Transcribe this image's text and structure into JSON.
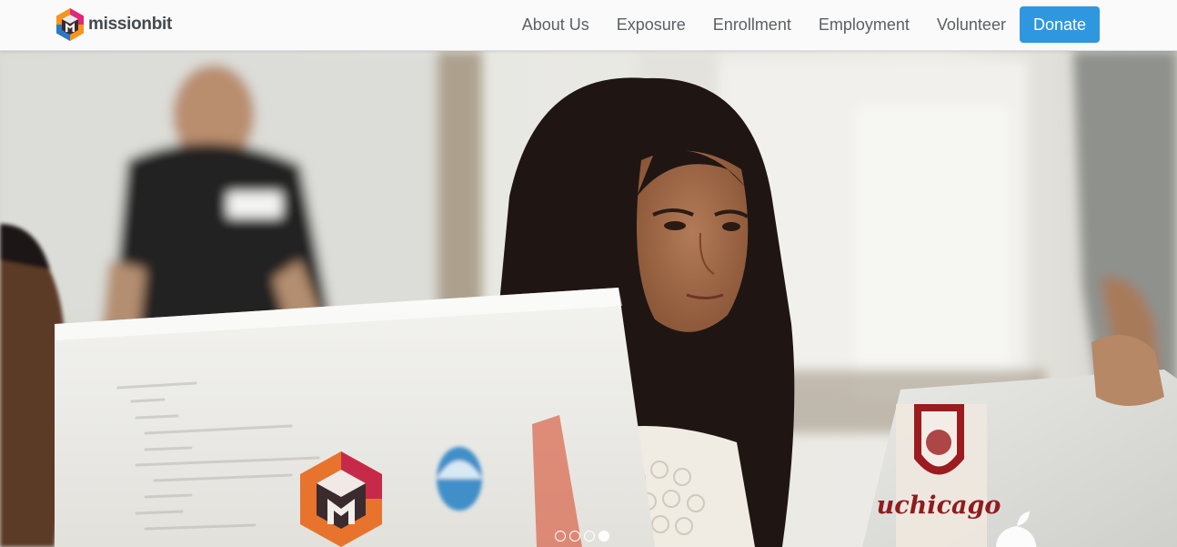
{
  "brand": {
    "name": "missionbit",
    "logo_colors": {
      "orange": "#f7941d",
      "magenta": "#e2267a",
      "blue": "#2b79c2",
      "dark": "#3b2b2e"
    }
  },
  "nav": {
    "items": [
      {
        "label": "About Us"
      },
      {
        "label": "Exposure"
      },
      {
        "label": "Enrollment"
      },
      {
        "label": "Employment"
      },
      {
        "label": "Volunteer"
      }
    ],
    "donate_label": "Donate",
    "donate_color": "#2f97e0"
  },
  "hero": {
    "sticker_text": "uchicago",
    "carousel": {
      "slide_count": 4,
      "active_index": 3
    }
  }
}
